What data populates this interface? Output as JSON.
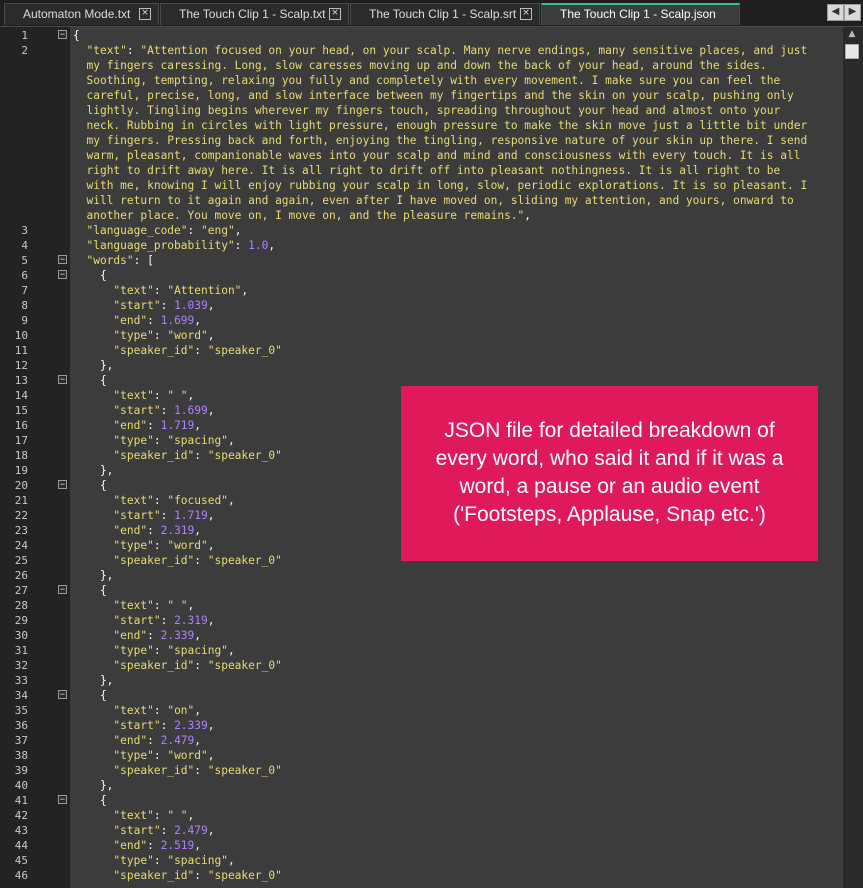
{
  "tabs": [
    {
      "label": "Automaton Mode.txt",
      "active": false
    },
    {
      "label": "The Touch Clip 1 - Scalp.txt",
      "active": false
    },
    {
      "label": "The Touch Clip 1 - Scalp.srt",
      "active": false
    },
    {
      "label": "The Touch Clip 1 - Scalp.json",
      "active": true
    }
  ],
  "tab_close_glyph": "×",
  "nav_prev": "◀",
  "nav_next": "▶",
  "scroll_up": "▲",
  "code": {
    "text_value_lines": [
      "\"Attention focused on your head, on your scalp. Many nerve endings, many sensitive places, and just",
      "my fingers caressing. Long, slow caresses moving up and down the back of your head, around the sides.",
      "Soothing, tempting, relaxing you fully and completely with every movement. I make sure you can feel the",
      "careful, precise, long, and slow interface between my fingertips and the skin on your scalp, pushing only",
      "lightly. Tingling begins wherever my fingers touch, spreading throughout your head and almost onto your",
      "neck. Rubbing in circles with light pressure, enough pressure to make the skin move just a little bit under",
      "my fingers. Pressing back and forth, enjoying the tingling, responsive nature of your skin up there. I send",
      "warm, pleasant, companionable waves into your scalp and mind and consciousness with every touch. It is all",
      "right to drift away here. It is all right to drift off into pleasant nothingness. It is all right to be",
      "with me, knowing I will enjoy rubbing your scalp in long, slow, periodic explorations. It is so pleasant. I",
      "will return to it again and again, even after I have moved on, sliding my attention, and yours, onward to",
      "another place. You move on, I move on, and the pleasure remains.\""
    ],
    "language_code": "\"eng\"",
    "language_probability": "1.0",
    "words": [
      {
        "text": "\"Attention\"",
        "start": "1.039",
        "end": "1.699",
        "type": "\"word\"",
        "speaker_id": "\"speaker_0\""
      },
      {
        "text": "\" \"",
        "start": "1.699",
        "end": "1.719",
        "type": "\"spacing\"",
        "speaker_id": "\"speaker_0\""
      },
      {
        "text": "\"focused\"",
        "start": "1.719",
        "end": "2.319",
        "type": "\"word\"",
        "speaker_id": "\"speaker_0\""
      },
      {
        "text": "\" \"",
        "start": "2.319",
        "end": "2.339",
        "type": "\"spacing\"",
        "speaker_id": "\"speaker_0\""
      },
      {
        "text": "\"on\"",
        "start": "2.339",
        "end": "2.479",
        "type": "\"word\"",
        "speaker_id": "\"speaker_0\""
      },
      {
        "text": "\" \"",
        "start": "2.479",
        "end": "2.519",
        "type": "\"spacing\"",
        "speaker_id": "\"speaker_0\""
      }
    ]
  },
  "callout": {
    "lines": [
      "JSON file for detailed breakdown of",
      "every word, who said it and if it was a",
      "word, a pause or an audio event",
      "('Footsteps, Applause, Snap etc.')"
    ]
  },
  "colors": {
    "key_string": "#e6db74",
    "number": "#ae81ff",
    "callout_bg": "#e01a5a",
    "active_tab_accent": "#35c38a"
  }
}
